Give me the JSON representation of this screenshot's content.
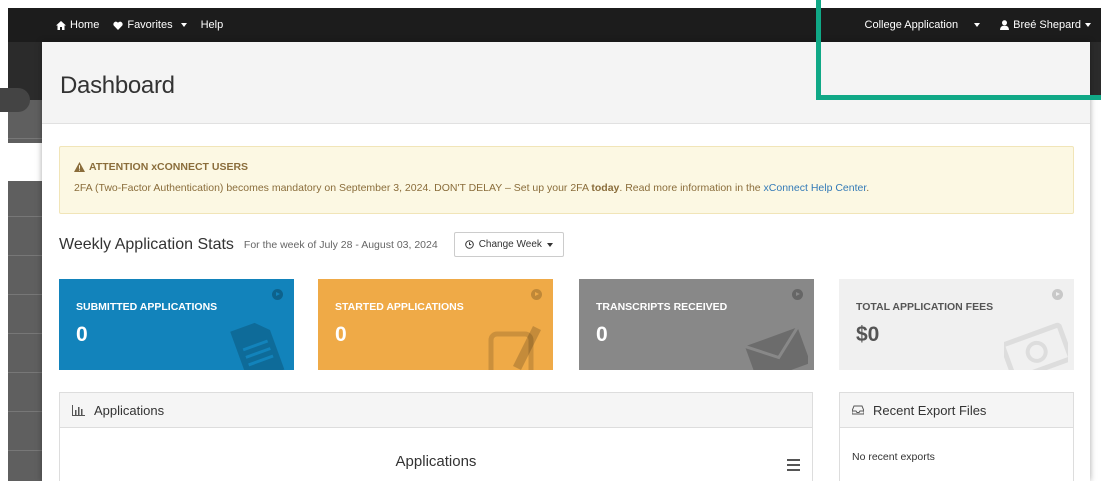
{
  "topnav": {
    "home": "Home",
    "favorites": "Favorites",
    "help": "Help",
    "app_selector": "College Application",
    "user": "Breé Shepard"
  },
  "page": {
    "title": "Dashboard"
  },
  "alert": {
    "title": "ATTENTION xCONNECT USERS",
    "body_before": "2FA (Two-Factor Authentication) becomes mandatory on September 3, 2024. DON'T DELAY – Set up your 2FA ",
    "body_bold": "today",
    "body_after": ". Read more information in the ",
    "link": "xConnect Help Center",
    "body_end": "."
  },
  "weekly": {
    "title": "Weekly Application Stats",
    "range": "For the week of July 28 - August 03, 2024",
    "change_week": "Change Week"
  },
  "stats": [
    {
      "label": "SUBMITTED APPLICATIONS",
      "value": "0",
      "color": "#1283bb"
    },
    {
      "label": "STARTED APPLICATIONS",
      "value": "0",
      "color": "#efaa47"
    },
    {
      "label": "TRANSCRIPTS RECEIVED",
      "value": "0",
      "color": "#888888"
    },
    {
      "label": "TOTAL APPLICATION FEES",
      "value": "$0",
      "color": "#f0f0f0"
    }
  ],
  "applications": {
    "header": "Applications",
    "chart_title": "Applications"
  },
  "exports": {
    "header": "Recent Export Files",
    "empty": "No recent exports"
  },
  "colors": {
    "accent_callout": "#10a886",
    "link": "#337ab7",
    "alert_bg": "#fcf8e3"
  }
}
